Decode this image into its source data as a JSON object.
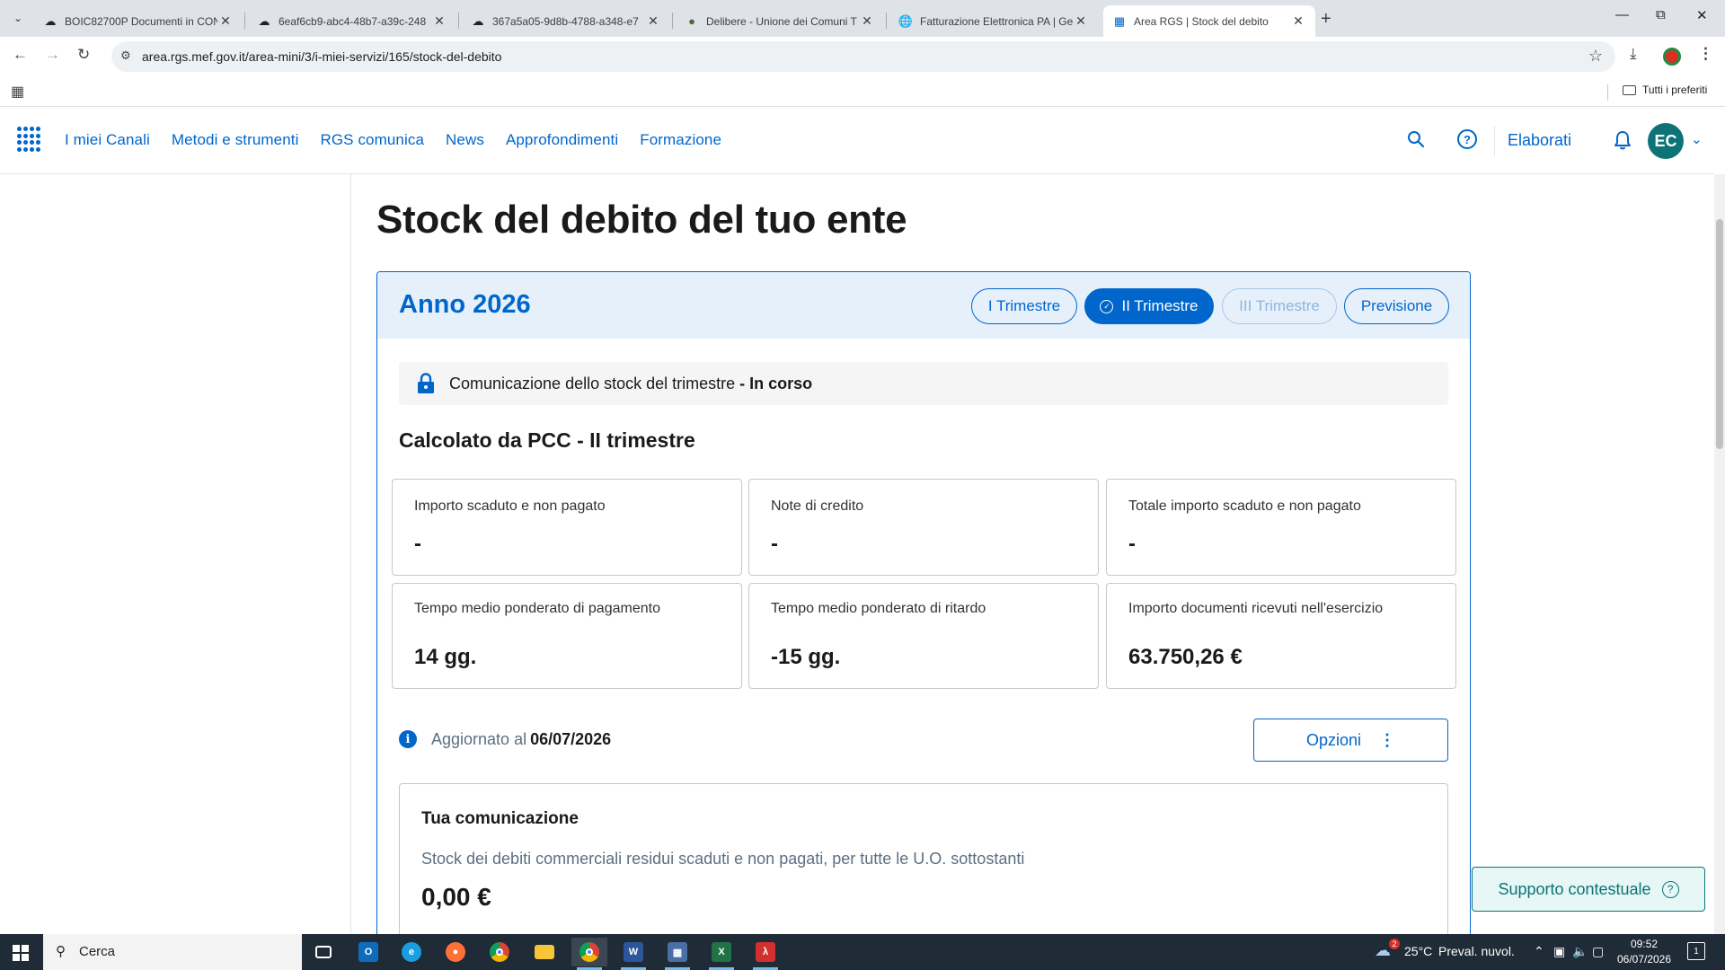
{
  "browser": {
    "tabs": [
      {
        "title": "BOIC82700P Documenti in CON",
        "icon": "cloud-icon"
      },
      {
        "title": "6eaf6cb9-abc4-48b7-a39c-248",
        "icon": "cloud-icon"
      },
      {
        "title": "367a5a05-9d8b-4788-a348-e7",
        "icon": "cloud-icon"
      },
      {
        "title": "Delibere - Unione dei Comuni T",
        "icon": "leaf-icon"
      },
      {
        "title": "Fatturazione Elettronica PA | Ge",
        "icon": "globe-icon"
      },
      {
        "title": "Area RGS | Stock del debito",
        "icon": "grid-icon"
      }
    ],
    "url": "area.rgs.mef.gov.it/area-mini/3/i-miei-servizi/165/stock-del-debito",
    "bookmarks_all": "Tutti i preferiti"
  },
  "header": {
    "nav": [
      "I miei Canali",
      "Metodi e strumenti",
      "RGS comunica",
      "News",
      "Approfondimenti",
      "Formazione"
    ],
    "elaborati": "Elaborati",
    "avatar": "EC"
  },
  "page": {
    "title": "Stock del debito del tuo ente",
    "year_title": "Anno 2026",
    "tabs": [
      {
        "label": "I Trimestre",
        "state": "normal"
      },
      {
        "label": "II Trimestre",
        "state": "active"
      },
      {
        "label": "III Trimestre",
        "state": "disabled"
      },
      {
        "label": "Previsione",
        "state": "normal"
      }
    ],
    "status": {
      "text": "Comunicazione dello stock del trimestre",
      "state": "- In corso"
    },
    "calc_title": "Calcolato da PCC - II trimestre",
    "metrics": [
      {
        "label": "Importo scaduto e non pagato",
        "value": "-"
      },
      {
        "label": "Note di credito",
        "value": "-"
      },
      {
        "label": "Totale importo scaduto e non pagato",
        "value": "-"
      },
      {
        "label": "Tempo medio ponderato di pagamento",
        "value": "14 gg."
      },
      {
        "label": "Tempo medio ponderato di ritardo",
        "value": "-15 gg."
      },
      {
        "label": "Importo documenti ricevuti nell'esercizio",
        "value": "63.750,26 €"
      }
    ],
    "updated_label": "Aggiornato al",
    "updated_date": "06/07/2026",
    "options_label": "Opzioni",
    "communication": {
      "title": "Tua comunicazione",
      "description": "Stock dei debiti commerciali residui scaduti e non pagati, per tutte le U.O. sottostanti",
      "value": "0,00 €"
    },
    "support_label": "Supporto contestuale"
  },
  "taskbar": {
    "search": "Cerca",
    "weather_badge": "2",
    "temperature": "25°C",
    "weather": "Preval. nuvol.",
    "time": "09:52",
    "date": "06/07/2026",
    "notifications": "1"
  },
  "colors": {
    "primary": "#0066cc",
    "teal": "#0d7377",
    "header_bg": "#e6f0fa"
  }
}
